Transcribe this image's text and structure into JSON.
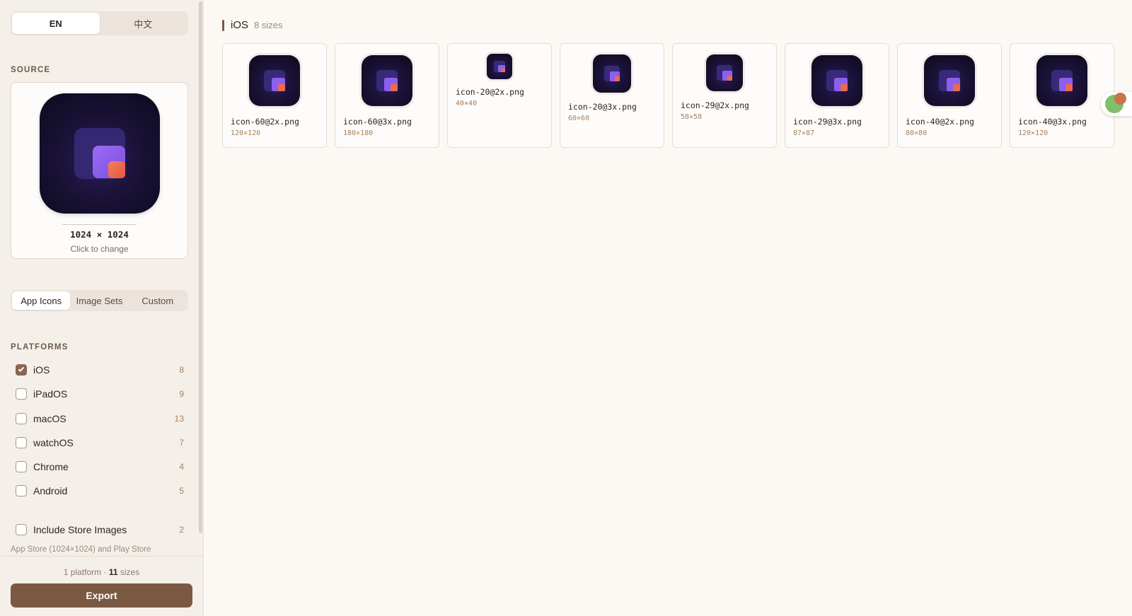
{
  "lang": {
    "en": "EN",
    "zh": "中文"
  },
  "source": {
    "label": "SOURCE",
    "dims": "1024 × 1024",
    "hint": "Click to change"
  },
  "modes": [
    "App Icons",
    "Image Sets",
    "Custom"
  ],
  "platforms_label": "PLATFORMS",
  "platforms": [
    {
      "name": "iOS",
      "count": "8",
      "checked": true
    },
    {
      "name": "iPadOS",
      "count": "9",
      "checked": false
    },
    {
      "name": "macOS",
      "count": "13",
      "checked": false
    },
    {
      "name": "watchOS",
      "count": "7",
      "checked": false
    },
    {
      "name": "Chrome",
      "count": "4",
      "checked": false
    },
    {
      "name": "Android",
      "count": "5",
      "checked": false
    }
  ],
  "store": {
    "label": "Include Store Images",
    "count": "2",
    "checked": false,
    "note": "App Store (1024×1024) and Play Store"
  },
  "summary": {
    "platforms": "1 platform · ",
    "sizes_count": "11",
    "sizes_word": " sizes"
  },
  "export_label": "Export",
  "group": {
    "title": "iOS",
    "count": "8 sizes",
    "tiles": [
      {
        "name": "icon-60@2x.png",
        "size": "120×120"
      },
      {
        "name": "icon-60@3x.png",
        "size": "180×180"
      },
      {
        "name": "icon-20@2x.png",
        "size": "40×40"
      },
      {
        "name": "icon-20@3x.png",
        "size": "60×60"
      },
      {
        "name": "icon-29@2x.png",
        "size": "58×58"
      },
      {
        "name": "icon-29@3x.png",
        "size": "87×87"
      },
      {
        "name": "icon-40@2x.png",
        "size": "80×80"
      },
      {
        "name": "icon-40@3x.png",
        "size": "120×120"
      }
    ]
  },
  "icons": {
    "translate": "translate-icon",
    "check": "check-icon"
  },
  "colors": {
    "accent": "#7a5943",
    "sidebar_bg": "#f5efe9",
    "main_bg": "#fcf9f5",
    "count": "#a67f5a"
  }
}
